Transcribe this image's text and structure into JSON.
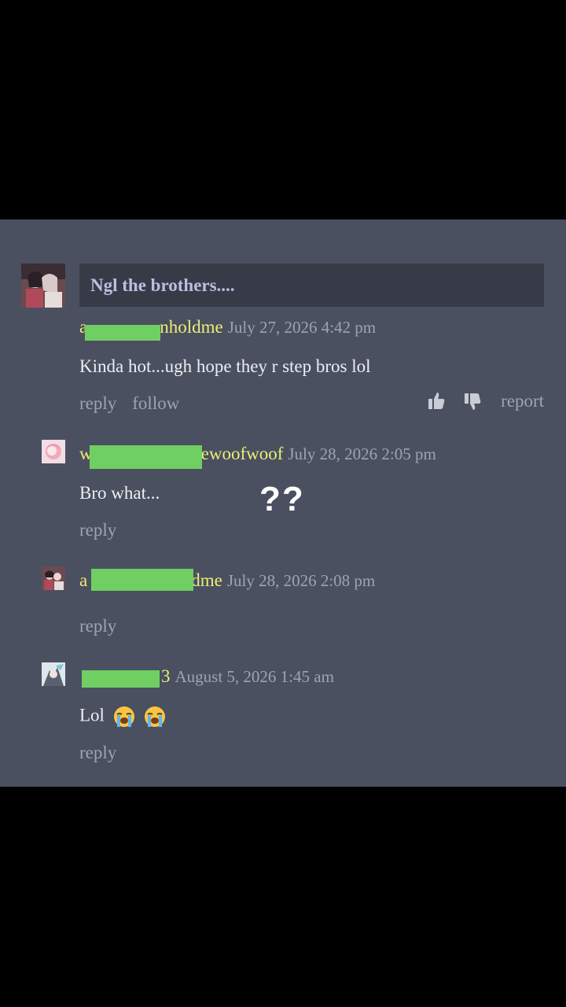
{
  "thread": {
    "title": "Ngl the brothers...."
  },
  "comments": [
    {
      "username_start": "a",
      "username_end": "nholdme",
      "date": "July 27, 2026 4:42 pm",
      "text": "Kinda hot...ugh hope they r step bros lol",
      "actions": [
        "reply",
        "follow"
      ],
      "report_label": "report"
    },
    {
      "username_start": "w",
      "username_end": "ewoofwoof",
      "date": "July 28, 2026 2:05 pm",
      "text": "Bro what...",
      "actions": [
        "reply"
      ]
    },
    {
      "username_start": "a",
      "username_end": "dme",
      "date": "July 28, 2026 2:08 pm",
      "text": "",
      "actions": [
        "reply"
      ]
    },
    {
      "username_start": "",
      "username_end": "3",
      "date": "August 5, 2026 1:45 am",
      "text": "Lol",
      "emoji": [
        "loudly-crying-face",
        "loudly-crying-face"
      ],
      "actions": [
        "reply"
      ]
    }
  ],
  "overlay": {
    "text": "??"
  },
  "colors": {
    "panel": "#4a5060",
    "title_box": "#373b47",
    "username": "#ecee74",
    "redaction": "#6fcf62",
    "muted": "#9ea3b3"
  }
}
